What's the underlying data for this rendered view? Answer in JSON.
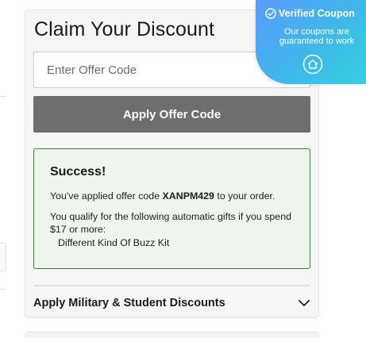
{
  "discount": {
    "title": "Claim Your Discount",
    "code_input": {
      "placeholder": "Enter Offer Code",
      "value": ""
    },
    "apply_button_label": "Apply Offer Code",
    "success": {
      "title": "Success!",
      "applied_prefix": "You've applied offer code ",
      "applied_code": "XANPM429",
      "applied_suffix": " to your order.",
      "qualify_text": "You qualify for the following automatic gifts if you spend $17 or more:",
      "gifts": [
        "Different Kind Of Buzz Kit"
      ]
    },
    "military": {
      "label": "Apply Military & Student Discounts",
      "icon": "chevron-down-icon"
    }
  },
  "badge": {
    "title": "Verified Coupon",
    "subtitle": "Our coupons are guaranteed to work",
    "title_icon": "check-circle-icon",
    "bottom_icon": "shield-home-icon"
  },
  "colors": {
    "card_background": "#f5f5f5",
    "apply_button": "#6e6e6e",
    "success_border": "#2f8a2f",
    "success_background": "#eef5ec",
    "badge_gradient_start": "#5a9cff",
    "badge_gradient_end": "#35cfe0"
  }
}
